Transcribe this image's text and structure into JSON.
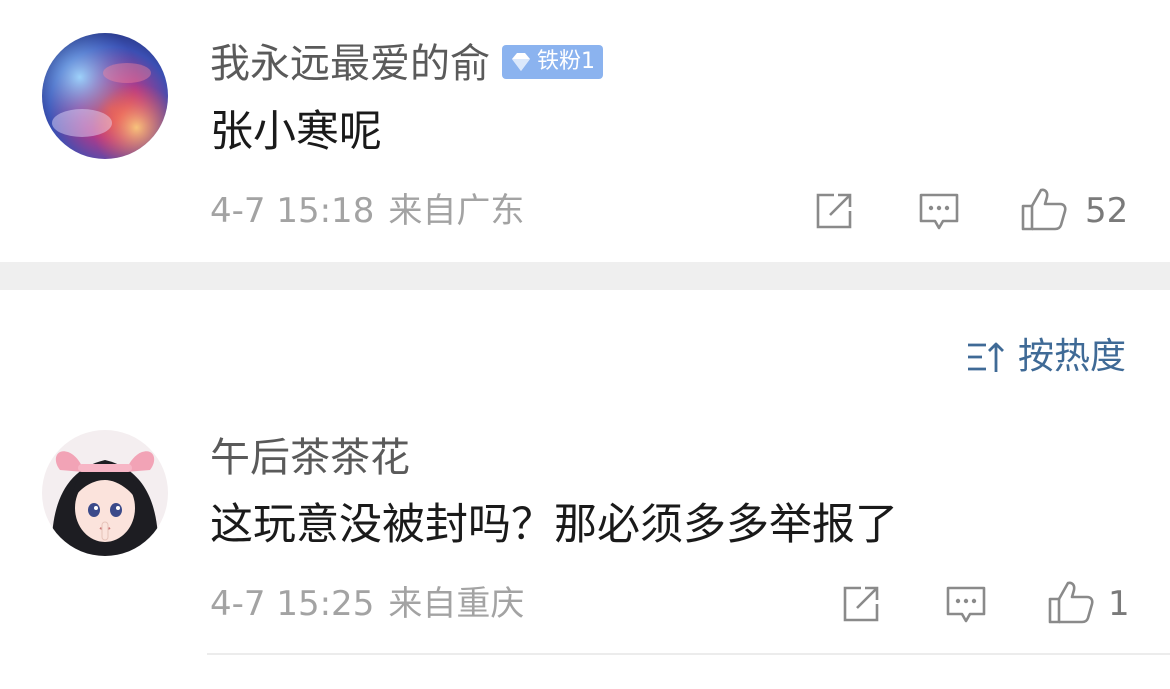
{
  "comments": [
    {
      "username": "我永远最爱的俞",
      "badge": "铁粉1",
      "text": "张小寒呢",
      "date": "4-7 15:18",
      "location": "来自广东",
      "likes": "52"
    },
    {
      "username": "午后茶茶花",
      "text": "这玩意没被封吗？那必须多多举报了",
      "date": "4-7 15:25",
      "location": "来自重庆",
      "likes": "1"
    }
  ],
  "sort": {
    "label": "按热度"
  },
  "colors": {
    "badge": "#8bb3ef",
    "sort_accent": "#3f6a96",
    "meta_text": "#a3a3a3",
    "divider": "#efefef"
  }
}
